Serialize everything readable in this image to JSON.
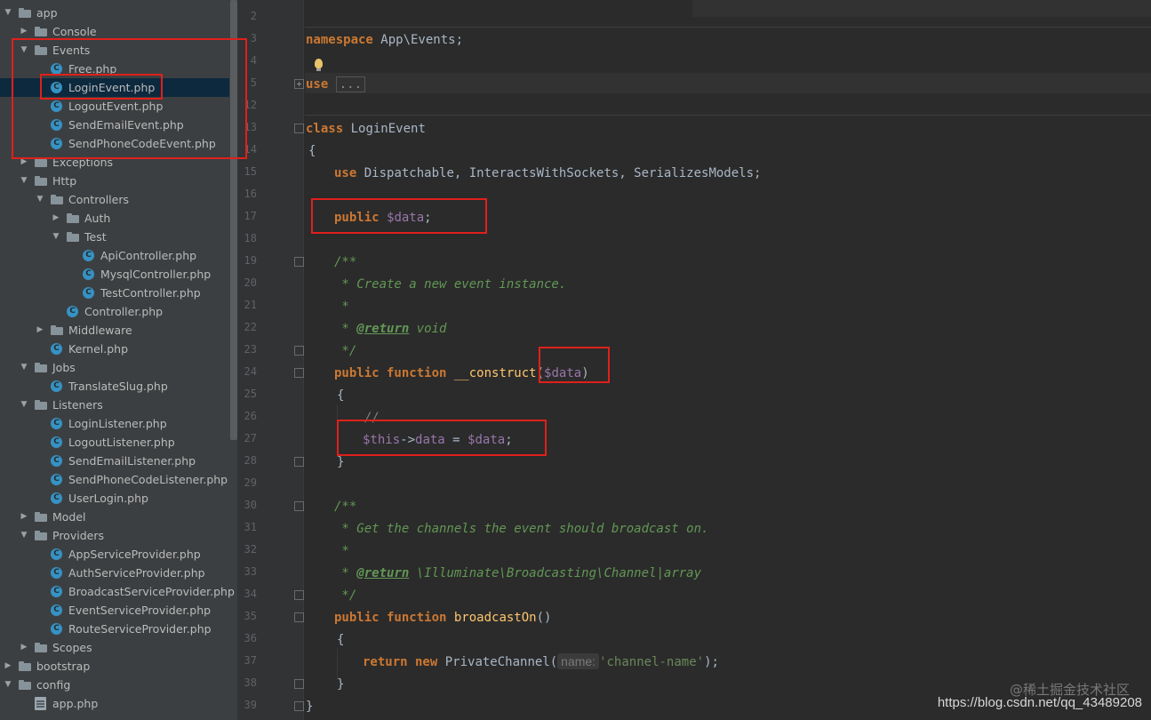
{
  "tree": {
    "rows": [
      {
        "label": "app",
        "kind": "folder",
        "expanded": true
      },
      {
        "label": "Console",
        "kind": "folder",
        "expanded": false
      },
      {
        "label": "Events",
        "kind": "folder",
        "expanded": true
      },
      {
        "label": "Free.php",
        "kind": "class"
      },
      {
        "label": "LoginEvent.php",
        "kind": "class",
        "selected": true
      },
      {
        "label": "LogoutEvent.php",
        "kind": "class"
      },
      {
        "label": "SendEmailEvent.php",
        "kind": "class"
      },
      {
        "label": "SendPhoneCodeEvent.php",
        "kind": "class"
      },
      {
        "label": "Exceptions",
        "kind": "folder",
        "expanded": false
      },
      {
        "label": "Http",
        "kind": "folder",
        "expanded": true
      },
      {
        "label": "Controllers",
        "kind": "folder",
        "expanded": true
      },
      {
        "label": "Auth",
        "kind": "folder",
        "expanded": false
      },
      {
        "label": "Test",
        "kind": "folder",
        "expanded": true
      },
      {
        "label": "ApiController.php",
        "kind": "class"
      },
      {
        "label": "MysqlController.php",
        "kind": "class"
      },
      {
        "label": "TestController.php",
        "kind": "class"
      },
      {
        "label": "Controller.php",
        "kind": "class"
      },
      {
        "label": "Middleware",
        "kind": "folder",
        "expanded": false
      },
      {
        "label": "Kernel.php",
        "kind": "class"
      },
      {
        "label": "Jobs",
        "kind": "folder",
        "expanded": true
      },
      {
        "label": "TranslateSlug.php",
        "kind": "class"
      },
      {
        "label": "Listeners",
        "kind": "folder",
        "expanded": true
      },
      {
        "label": "LoginListener.php",
        "kind": "class"
      },
      {
        "label": "LogoutListener.php",
        "kind": "class"
      },
      {
        "label": "SendEmailListener.php",
        "kind": "class"
      },
      {
        "label": "SendPhoneCodeListener.php",
        "kind": "class"
      },
      {
        "label": "UserLogin.php",
        "kind": "class"
      },
      {
        "label": "Model",
        "kind": "folder",
        "expanded": false
      },
      {
        "label": "Providers",
        "kind": "folder",
        "expanded": true
      },
      {
        "label": "AppServiceProvider.php",
        "kind": "class"
      },
      {
        "label": "AuthServiceProvider.php",
        "kind": "class"
      },
      {
        "label": "BroadcastServiceProvider.php",
        "kind": "class"
      },
      {
        "label": "EventServiceProvider.php",
        "kind": "class"
      },
      {
        "label": "RouteServiceProvider.php",
        "kind": "class"
      },
      {
        "label": "Scopes",
        "kind": "folder",
        "expanded": false
      },
      {
        "label": "bootstrap",
        "kind": "folder",
        "expanded": false
      },
      {
        "label": "config",
        "kind": "folder",
        "expanded": true
      },
      {
        "label": "app.php",
        "kind": "file"
      }
    ]
  },
  "editor": {
    "line_numbers": [
      "2",
      "3",
      "4",
      "5",
      "12",
      "13",
      "14",
      "15",
      "16",
      "17",
      "18",
      "19",
      "20",
      "21",
      "22",
      "23",
      "24",
      "25",
      "26",
      "27",
      "28",
      "29",
      "30",
      "31",
      "32",
      "33",
      "34",
      "35",
      "36",
      "37",
      "38",
      "39"
    ],
    "code": {
      "namespace_kw": "namespace",
      "namespace_name": " App\\Events;",
      "use_kw": "use",
      "use_folded": "...",
      "class_kw": "class",
      "class_name": " LoginEvent",
      "brace_open": "{",
      "traits_kw": "use",
      "traits": " Dispatchable, InteractsWithSockets, SerializesModels;",
      "prop_kw": "public",
      "prop_var": "$data",
      "prop_end": ";",
      "doc1_open": "/**",
      "doc1_line1": " * Create a new event instance.",
      "doc1_line2": " *",
      "doc1_tag_prefix": " * ",
      "doc1_tag": "@return",
      "doc1_tag_type": " void",
      "doc1_close": " */",
      "ctor_kw": "public function",
      "ctor_name": "__construct",
      "ctor_paren_open": "(",
      "ctor_param": "$data",
      "ctor_paren_close": ")",
      "ctor_brace_open": "{",
      "ctor_comment": "//",
      "ctor_this": "$this",
      "ctor_arrow": "->",
      "ctor_prop": "data",
      "ctor_assign": " = ",
      "ctor_rhs": "$data",
      "ctor_end": ";",
      "ctor_brace_close": "}",
      "doc2_open": "/**",
      "doc2_line1": " * Get the channels the event should broadcast on.",
      "doc2_line2": " *",
      "doc2_tag_prefix": " * ",
      "doc2_tag": "@return",
      "doc2_tag_type": " \\Illuminate\\Broadcasting\\Channel|array",
      "doc2_close": " */",
      "bo_kw": "public function",
      "bo_name": "broadcastOn",
      "bo_parens": "()",
      "bo_brace_open": "{",
      "ret_kw": "return new",
      "ret_class": " PrivateChannel(",
      "ret_hint": "name:",
      "ret_str": "'channel-name'",
      "ret_end": ");",
      "bo_brace_close": "}",
      "class_brace_close": "}"
    }
  },
  "watermark": "@稀土掘金技术社区",
  "url": "https://blog.csdn.net/qq_43489208",
  "colors": {
    "annotation_red": "#e0201b",
    "keyword": "#cc7832",
    "variable": "#9876aa",
    "function": "#ffc66d",
    "string": "#6a8759",
    "doc_comment": "#629755"
  }
}
